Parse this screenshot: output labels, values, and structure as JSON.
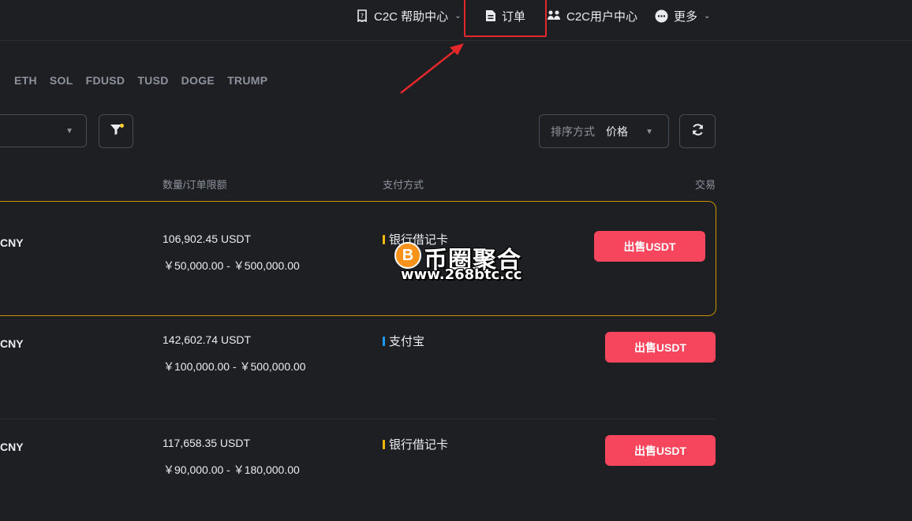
{
  "nav": {
    "help": "C2C 帮助中心",
    "orders": "订单",
    "user_center": "C2C用户中心",
    "more": "更多"
  },
  "coin_tabs": [
    "ETH",
    "SOL",
    "FDUSD",
    "TUSD",
    "DOGE",
    "TRUMP"
  ],
  "sort": {
    "label": "排序方式",
    "value": "价格"
  },
  "table_headers": {
    "quantity": "数量/订单限额",
    "payment": "支付方式",
    "trade": "交易"
  },
  "rows": [
    {
      "fiat": "CNY",
      "quantity": "106,902.45 USDT",
      "limit": "￥50,000.00 - ￥500,000.00",
      "payment": "银行借记卡",
      "pay_color": "#f0b90b",
      "button": "出售USDT"
    },
    {
      "fiat": "CNY",
      "quantity": "142,602.74 USDT",
      "limit": "￥100,000.00 - ￥500,000.00",
      "payment": "支付宝",
      "pay_color": "#1e9bf0",
      "button": "出售USDT"
    },
    {
      "fiat": "CNY",
      "quantity": "117,658.35 USDT",
      "limit": "￥90,000.00 - ￥180,000.00",
      "payment": "银行借记卡",
      "pay_color": "#f0b90b",
      "button": "出售USDT"
    }
  ],
  "watermark": {
    "coin_letter": "B",
    "title": "币圈聚合",
    "url": "www.268btc.cc"
  },
  "colors": {
    "accent": "#f6465d",
    "highlight": "#e3272b",
    "gold": "#c99400"
  }
}
